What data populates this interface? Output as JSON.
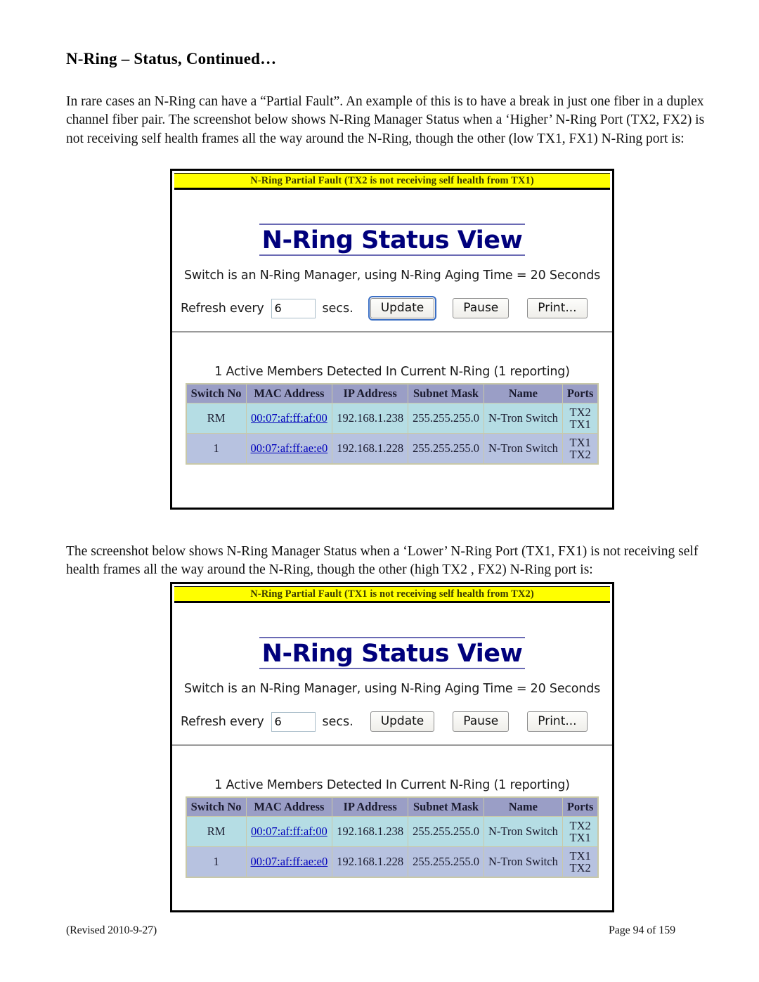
{
  "document": {
    "title": "N-Ring – Status, Continued…",
    "paragraph_1": "In rare cases an N-Ring can have a “Partial Fault”.  An example of this is to have a break in just one fiber in a duplex channel fiber pair.  The screenshot below shows N-Ring Manager Status when a ‘Higher’ N-Ring Port (TX2, FX2) is not receiving self health frames all the way around the N-Ring, though the other (low TX1, FX1) N-Ring port is:",
    "paragraph_2": "The screenshot below shows N-Ring Manager Status when a ‘Lower’ N-Ring Port (TX1, FX1) is not receiving self health frames all the way around the N-Ring, though the other (high TX2 , FX2) N-Ring port is:",
    "footer_left": "(Revised 2010-9-27)",
    "footer_right": "Page 94 of 159"
  },
  "colors": {
    "banner_bg": "#ffff00",
    "title_blue": "#00007c",
    "table_header_bg": "#9a9ec6",
    "row_rm_bg": "#b5dde4",
    "row_1_bg": "#b7c2e0",
    "link_blue": "#0000bb"
  },
  "screenshot_1": {
    "banner": "N-Ring Partial Fault (TX2 is not receiving self health from TX1)",
    "view_title": "N-Ring Status View",
    "subtitle": "Switch is an N-Ring Manager, using N-Ring Aging Time = 20 Seconds",
    "refresh_label": "Refresh every",
    "refresh_value": "6",
    "refresh_placeholder": "",
    "secs_label": "secs.",
    "update_label": "Update",
    "pause_label": "Pause",
    "print_label": "Print...",
    "members_caption": "1 Active Members Detected In Current N-Ring (1 reporting)",
    "table": {
      "headers": [
        "Switch No",
        "MAC Address",
        "IP Address",
        "Subnet Mask",
        "Name",
        "Ports"
      ],
      "rows": [
        {
          "switch_no": "RM",
          "mac": "00:07:af:ff:af:00",
          "ip": "192.168.1.238",
          "mask": "255.255.255.0",
          "name": "N-Tron Switch",
          "port_a": "TX2",
          "port_b": "TX1"
        },
        {
          "switch_no": "1",
          "mac": "00:07:af:ff:ae:e0",
          "ip": "192.168.1.228",
          "mask": "255.255.255.0",
          "name": "N-Tron Switch",
          "port_a": "TX1",
          "port_b": "TX2"
        }
      ]
    }
  },
  "screenshot_2": {
    "banner": "N-Ring Partial Fault (TX1 is not receiving self health from TX2)",
    "view_title": "N-Ring Status View",
    "subtitle": "Switch is an N-Ring Manager, using N-Ring Aging Time = 20 Seconds",
    "refresh_label": "Refresh every",
    "refresh_value": "6",
    "refresh_placeholder": "",
    "secs_label": "secs.",
    "update_label": "Update",
    "pause_label": "Pause",
    "print_label": "Print...",
    "members_caption": "1 Active Members Detected In Current N-Ring (1 reporting)",
    "table": {
      "headers": [
        "Switch No",
        "MAC Address",
        "IP Address",
        "Subnet Mask",
        "Name",
        "Ports"
      ],
      "rows": [
        {
          "switch_no": "RM",
          "mac": "00:07:af:ff:af:00",
          "ip": "192.168.1.238",
          "mask": "255.255.255.0",
          "name": "N-Tron Switch",
          "port_a": "TX2",
          "port_b": "TX1"
        },
        {
          "switch_no": "1",
          "mac": "00:07:af:ff:ae:e0",
          "ip": "192.168.1.228",
          "mask": "255.255.255.0",
          "name": "N-Tron Switch",
          "port_a": "TX1",
          "port_b": "TX2"
        }
      ]
    }
  }
}
